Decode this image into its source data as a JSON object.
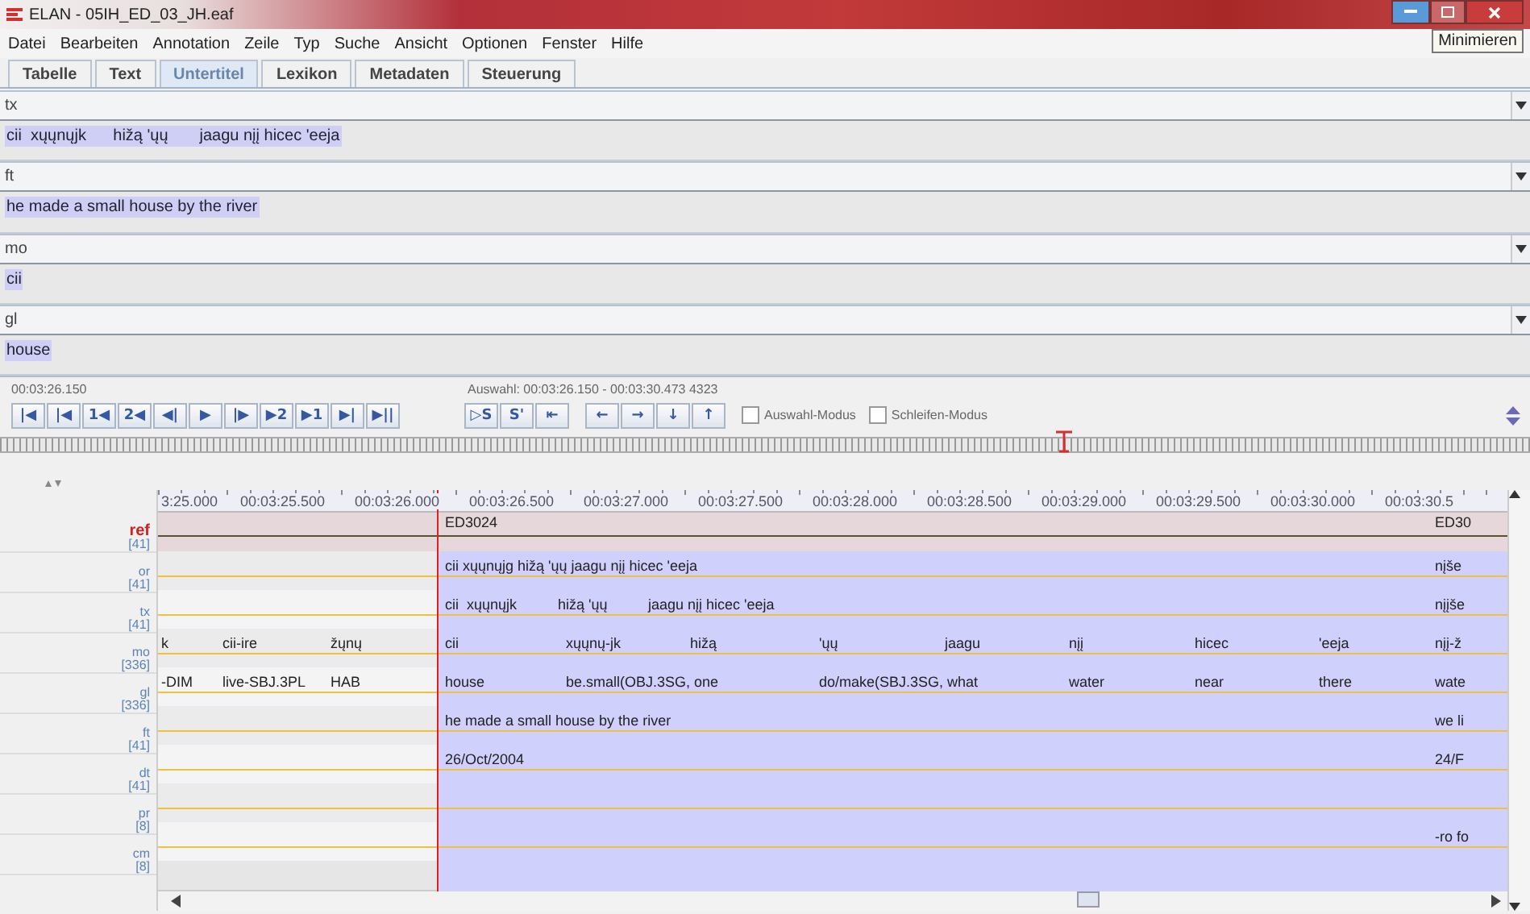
{
  "window": {
    "title": "ELAN - 05IH_ED_03_JH.eaf",
    "tooltip": "Minimieren"
  },
  "menu": [
    "Datei",
    "Bearbeiten",
    "Annotation",
    "Zeile",
    "Typ",
    "Suche",
    "Ansicht",
    "Optionen",
    "Fenster",
    "Hilfe"
  ],
  "tabs": [
    {
      "label": "Tabelle",
      "selected": false
    },
    {
      "label": "Text",
      "selected": false
    },
    {
      "label": "Untertitel",
      "selected": true
    },
    {
      "label": "Lexikon",
      "selected": false
    },
    {
      "label": "Metadaten",
      "selected": false
    },
    {
      "label": "Steuerung",
      "selected": false
    }
  ],
  "subtitles": [
    {
      "tier": "tx",
      "text": "cii  xųųnųjk      hižą 'ųų       jaagu nįį hicec 'eeja"
    },
    {
      "tier": "ft",
      "text": "he made a small house by the river"
    },
    {
      "tier": "mo",
      "text": "cii"
    },
    {
      "tier": "gl",
      "text": "house"
    }
  ],
  "player": {
    "time": "00:03:26.150",
    "selection": "Auswahl: 00:03:26.150 - 00:03:30.473  4323",
    "nav_buttons": [
      {
        "glyph": "|◀"
      },
      {
        "glyph": "|◀"
      },
      {
        "glyph": "1◀"
      },
      {
        "glyph": "2◀"
      },
      {
        "glyph": "◀|"
      },
      {
        "glyph": "▶"
      },
      {
        "glyph": "|▶"
      },
      {
        "glyph": "▶2"
      },
      {
        "glyph": "▶1"
      },
      {
        "glyph": "▶|"
      },
      {
        "glyph": "▶||"
      }
    ],
    "selection_buttons": [
      {
        "glyph": "▷S"
      },
      {
        "glyph": "S'"
      },
      {
        "glyph": "⇤"
      }
    ],
    "arrow_buttons": [
      {
        "glyph": "←"
      },
      {
        "glyph": "→"
      },
      {
        "glyph": "↓"
      },
      {
        "glyph": "↑"
      }
    ],
    "modes": [
      {
        "label": "Auswahl-Modus",
        "checked": false
      },
      {
        "label": "Schleifen-Modus",
        "checked": false
      }
    ]
  },
  "timeline": {
    "ruler": [
      "3:25.000",
      "00:03:25.500",
      "00:03:26.000",
      "00:03:26.500",
      "00:03:27.000",
      "00:03:27.500",
      "00:03:28.000",
      "00:03:28.500",
      "00:03:29.000",
      "00:03:29.500",
      "00:03:30.000",
      "00:03:30.5"
    ],
    "tiers": [
      {
        "name": "ref",
        "count": "[41]",
        "active": true,
        "annotations": [
          "ED3024"
        ],
        "cut": "ED30"
      },
      {
        "name": "or",
        "count": "[41]",
        "active": false,
        "annotations": [
          "cii xųųnųjg hižą 'ųų jaagu nįį hicec 'eeja"
        ],
        "cut": "nįše"
      },
      {
        "name": "tx",
        "count": "[41]",
        "active": false,
        "annotations": [
          "cii  xųųnųjk",
          "hižą 'ųų",
          "jaagu nįį hicec 'eeja"
        ],
        "cut": "nįįše"
      },
      {
        "name": "mo",
        "count": "[336]",
        "active": false,
        "annotations": [
          "k",
          "cii-ire",
          "žųnų",
          "cii",
          "xųųnų-jk",
          "hižą",
          "'ųų",
          "jaagu",
          "nįį",
          "hicec",
          "'eeja"
        ],
        "cut": "nįį-ž"
      },
      {
        "name": "gl",
        "count": "[336]",
        "active": false,
        "annotations": [
          "-DIM",
          "live-SBJ.3PL",
          "HAB",
          "house",
          "be.small(OBJ.3SG, one",
          "do/make(SBJ.3SG, what",
          "water",
          "near",
          "there"
        ],
        "cut": "wate"
      },
      {
        "name": "ft",
        "count": "[41]",
        "active": false,
        "annotations": [
          "he made a small house by the river"
        ],
        "cut": "we li"
      },
      {
        "name": "dt",
        "count": "[41]",
        "active": false,
        "annotations": [
          "26/Oct/2004"
        ],
        "cut": "24/F"
      },
      {
        "name": "pr",
        "count": "[8]",
        "active": false
      },
      {
        "name": "cm",
        "count": "[8]",
        "active": false,
        "cut": "-ro fo"
      }
    ]
  }
}
